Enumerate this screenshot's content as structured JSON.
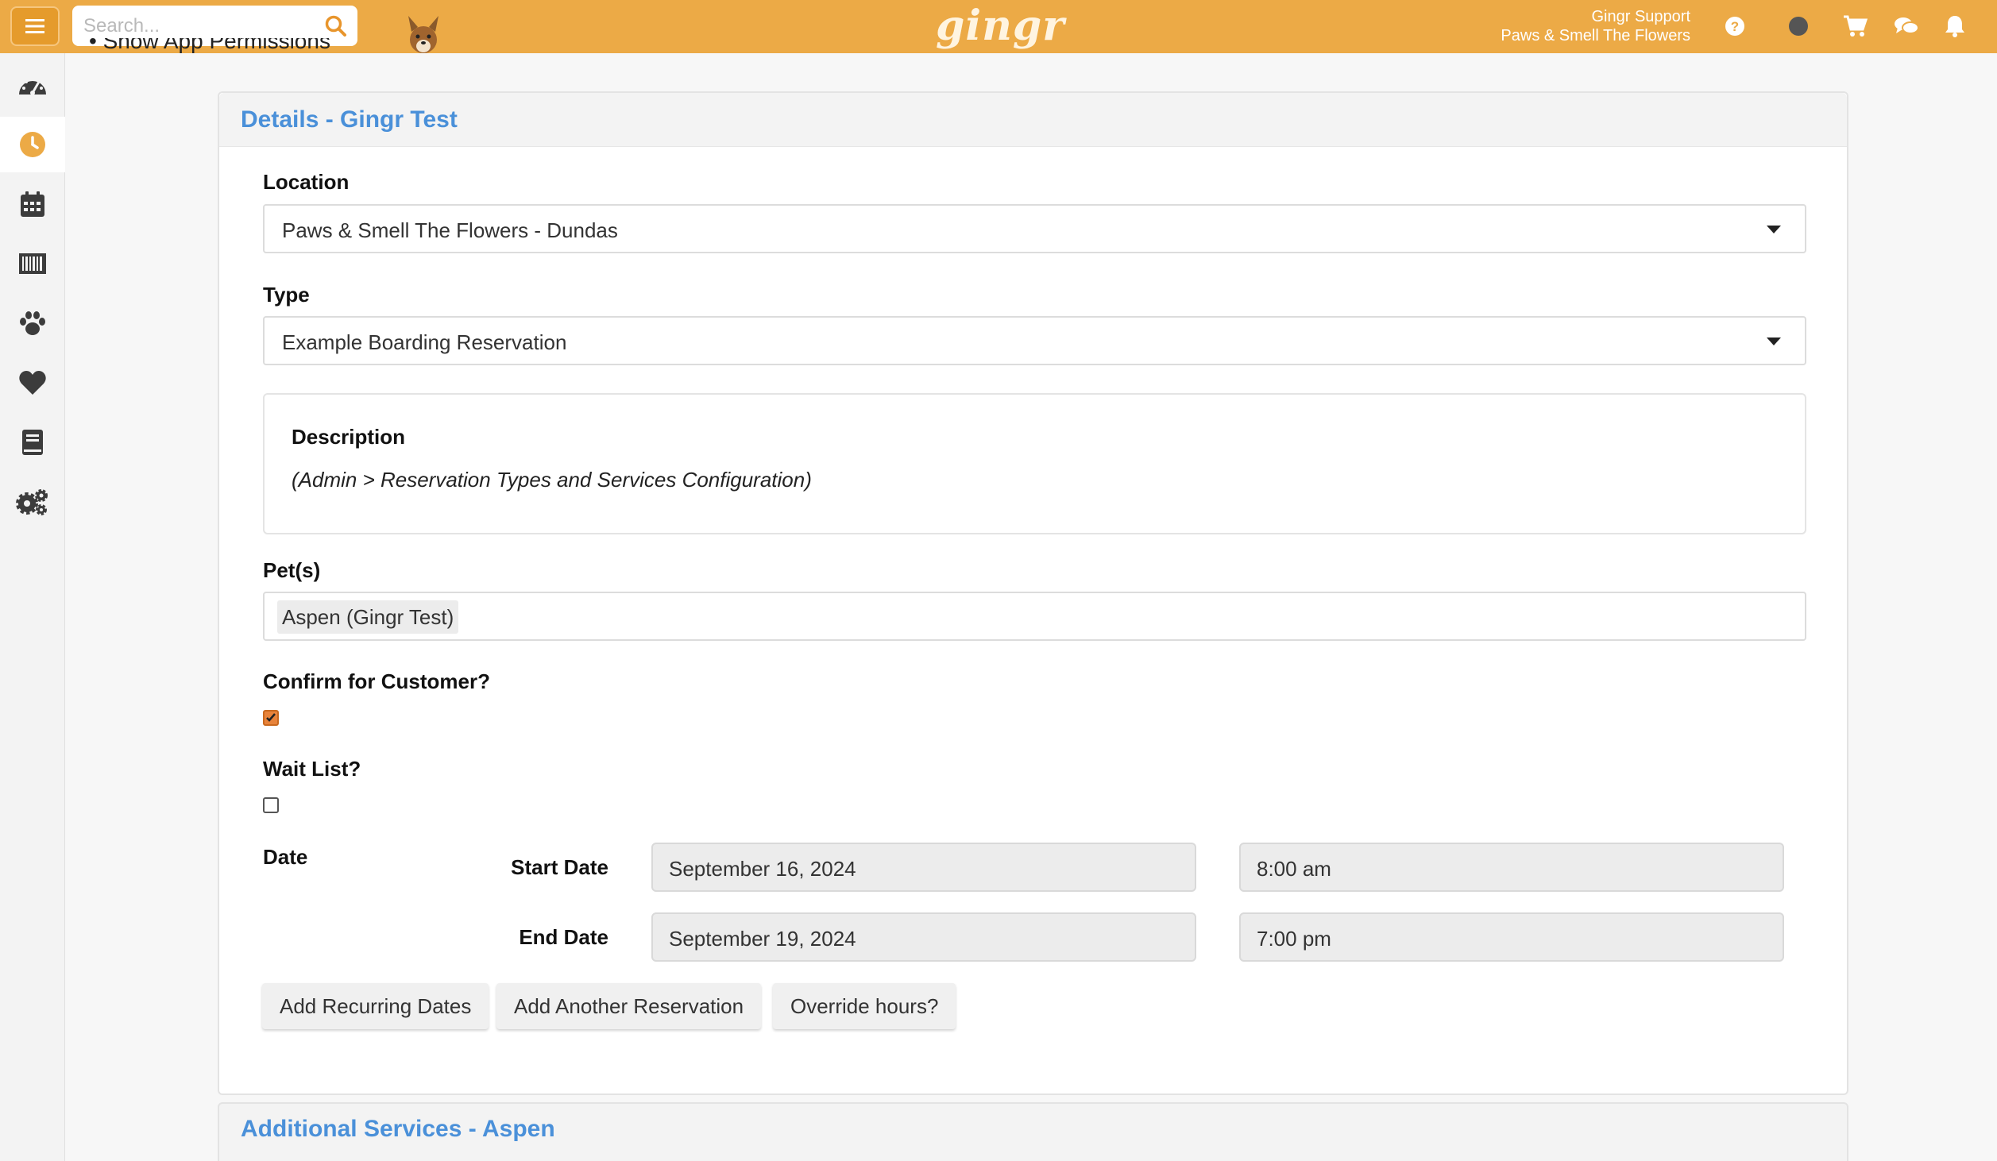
{
  "header": {
    "search_placeholder": "Search...",
    "brand": "gingr",
    "user_name": "Gingr Support",
    "user_org": "Paws & Smell The Flowers",
    "accent_color": "#ecaa46"
  },
  "sidebar": {
    "items": [
      {
        "icon": "dashboard-gauge-icon"
      },
      {
        "icon": "clock-icon",
        "active": true
      },
      {
        "icon": "calendar-icon"
      },
      {
        "icon": "barcode-icon"
      },
      {
        "icon": "paw-icon"
      },
      {
        "icon": "heart-icon"
      },
      {
        "icon": "book-icon"
      },
      {
        "icon": "gears-icon"
      }
    ]
  },
  "peek_text": "Show App Permissions",
  "details": {
    "title": "Details - Gingr Test",
    "location_label": "Location",
    "location_value": "Paws & Smell The Flowers - Dundas",
    "type_label": "Type",
    "type_value": "Example Boarding Reservation",
    "description_title": "Description",
    "description_text": "(Admin > Reservation Types and Services Configuration)",
    "pets_label": "Pet(s)",
    "pet_chip": "Aspen (Gingr Test)",
    "confirm_label": "Confirm for Customer?",
    "confirm_checked": true,
    "waitlist_label": "Wait List?",
    "waitlist_checked": false,
    "date_label": "Date",
    "start_label": "Start Date",
    "start_date": "September 16, 2024",
    "start_time": "8:00 am",
    "end_label": "End Date",
    "end_date": "September 19, 2024",
    "end_time": "7:00 pm",
    "buttons": {
      "recurring": "Add Recurring Dates",
      "another": "Add Another Reservation",
      "override": "Override hours?"
    }
  },
  "additional": {
    "title": "Additional Services - Aspen"
  }
}
